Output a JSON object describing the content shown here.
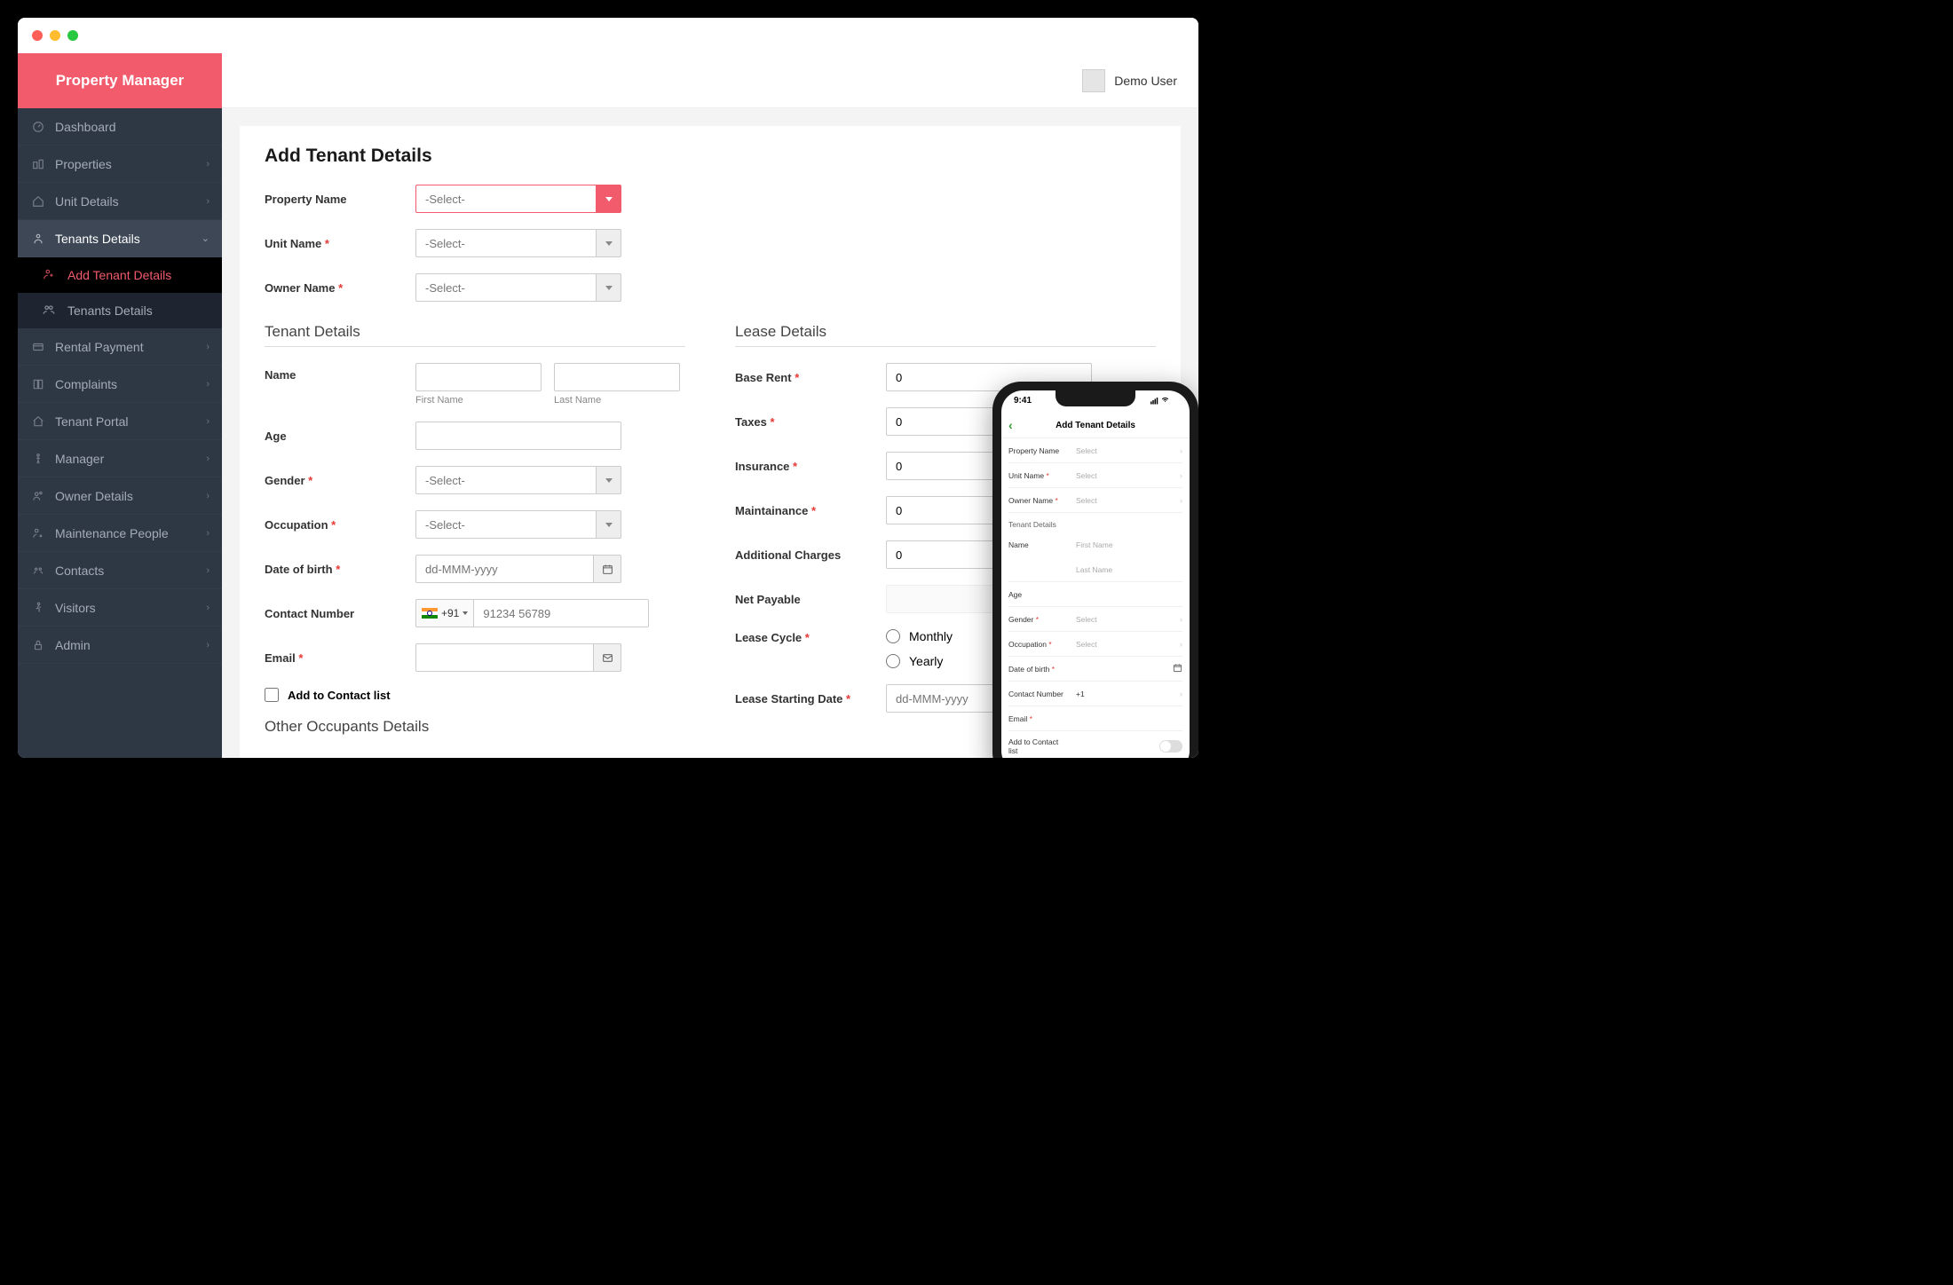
{
  "brand": "Property Manager",
  "user": {
    "name": "Demo User"
  },
  "sidebar": {
    "items": [
      {
        "label": "Dashboard",
        "icon": "gauge",
        "expandable": false
      },
      {
        "label": "Properties",
        "icon": "buildings",
        "expandable": true
      },
      {
        "label": "Unit Details",
        "icon": "home",
        "expandable": true
      },
      {
        "label": "Tenants Details",
        "icon": "person",
        "expandable": true,
        "active": true,
        "children": [
          {
            "label": "Add Tenant Details",
            "active": true
          },
          {
            "label": "Tenants Details",
            "active": false
          }
        ]
      },
      {
        "label": "Rental Payment",
        "icon": "card",
        "expandable": true
      },
      {
        "label": "Complaints",
        "icon": "book",
        "expandable": true
      },
      {
        "label": "Tenant Portal",
        "icon": "house",
        "expandable": true
      },
      {
        "label": "Manager",
        "icon": "person-standing",
        "expandable": true
      },
      {
        "label": "Owner Details",
        "icon": "person-group",
        "expandable": true
      },
      {
        "label": "Maintenance People",
        "icon": "person-wrench",
        "expandable": true
      },
      {
        "label": "Contacts",
        "icon": "people",
        "expandable": true
      },
      {
        "label": "Visitors",
        "icon": "walking",
        "expandable": true
      },
      {
        "label": "Admin",
        "icon": "lock",
        "expandable": true
      }
    ]
  },
  "page": {
    "title": "Add Tenant Details",
    "propertyName": {
      "label": "Property Name",
      "value": "-Select-"
    },
    "unitName": {
      "label": "Unit Name",
      "required": true,
      "value": "-Select-"
    },
    "ownerName": {
      "label": "Owner Name",
      "required": true,
      "value": "-Select-"
    },
    "tenantSection": "Tenant Details",
    "leaseSection": "Lease Details",
    "otherSection": "Other Occupants Details",
    "tenant": {
      "name": {
        "label": "Name",
        "first_hint": "First Name",
        "last_hint": "Last Name"
      },
      "age": {
        "label": "Age"
      },
      "gender": {
        "label": "Gender",
        "required": true,
        "value": "-Select-"
      },
      "occupation": {
        "label": "Occupation",
        "required": true,
        "value": "-Select-"
      },
      "dob": {
        "label": "Date of birth",
        "required": true,
        "placeholder": "dd-MMM-yyyy"
      },
      "contact": {
        "label": "Contact Number",
        "code": "+91",
        "placeholder": "91234 56789"
      },
      "email": {
        "label": "Email",
        "required": true
      },
      "addContact": {
        "label": "Add to Contact list"
      }
    },
    "lease": {
      "baseRent": {
        "label": "Base Rent",
        "required": true,
        "value": "0"
      },
      "taxes": {
        "label": "Taxes",
        "required": true,
        "value": "0"
      },
      "insurance": {
        "label": "Insurance",
        "required": true,
        "value": "0"
      },
      "maintenance": {
        "label": "Maintainance",
        "required": true,
        "value": "0"
      },
      "additional": {
        "label": "Additional Charges",
        "value": "0"
      },
      "netPayable": {
        "label": "Net Payable"
      },
      "leaseCycle": {
        "label": "Lease Cycle",
        "required": true,
        "options": [
          "Monthly",
          "Yearly"
        ]
      },
      "leaseStart": {
        "label": "Lease Starting Date",
        "required": true,
        "placeholder": "dd-MMM-yyyy"
      }
    }
  },
  "mobile": {
    "time": "9:41",
    "title": "Add Tenant Details",
    "rows": {
      "propertyName": {
        "label": "Property Name",
        "value": "Select"
      },
      "unitName": {
        "label": "Unit Name",
        "required": true,
        "value": "Select"
      },
      "ownerName": {
        "label": "Owner Name",
        "required": true,
        "value": "Select"
      },
      "section": "Tenant Details",
      "name": {
        "label": "Name",
        "first": "First Name",
        "last": "Last Name"
      },
      "age": {
        "label": "Age"
      },
      "gender": {
        "label": "Gender",
        "required": true,
        "value": "Select"
      },
      "occupation": {
        "label": "Occupation",
        "required": true,
        "value": "Select"
      },
      "dob": {
        "label": "Date of birth",
        "required": true
      },
      "contact": {
        "label": "Contact Number",
        "code": "+1"
      },
      "email": {
        "label": "Email",
        "required": true
      },
      "addContact": {
        "label": "Add to Contact list"
      }
    }
  }
}
